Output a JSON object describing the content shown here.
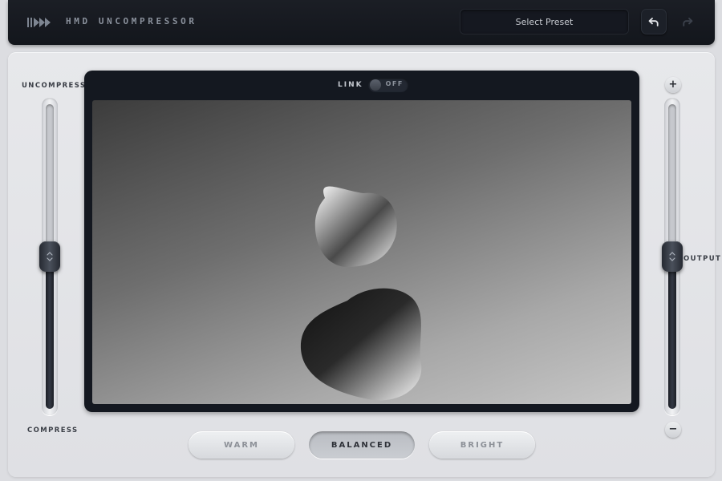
{
  "app": {
    "title": "HMD UNCOMPRESSOR"
  },
  "header": {
    "preset_label": "Select Preset",
    "undo_icon": "undo-icon",
    "redo_icon": "redo-icon"
  },
  "left_slider": {
    "top_label": "UNCOMPRESS",
    "bottom_label": "COMPRESS",
    "value_fraction": 0.5
  },
  "right_slider": {
    "label": "OUTPUT",
    "plus_label": "+",
    "minus_label": "−",
    "value_fraction": 0.5
  },
  "display": {
    "link_label": "LINK",
    "link_state": "OFF"
  },
  "modes": [
    {
      "label": "WARM",
      "active": false
    },
    {
      "label": "BALANCED",
      "active": true
    },
    {
      "label": "BRIGHT",
      "active": false
    }
  ],
  "colors": {
    "header_bg": "#16191f",
    "panel_bg": "#e3e4e7",
    "accent_dark": "#1b1e25"
  }
}
